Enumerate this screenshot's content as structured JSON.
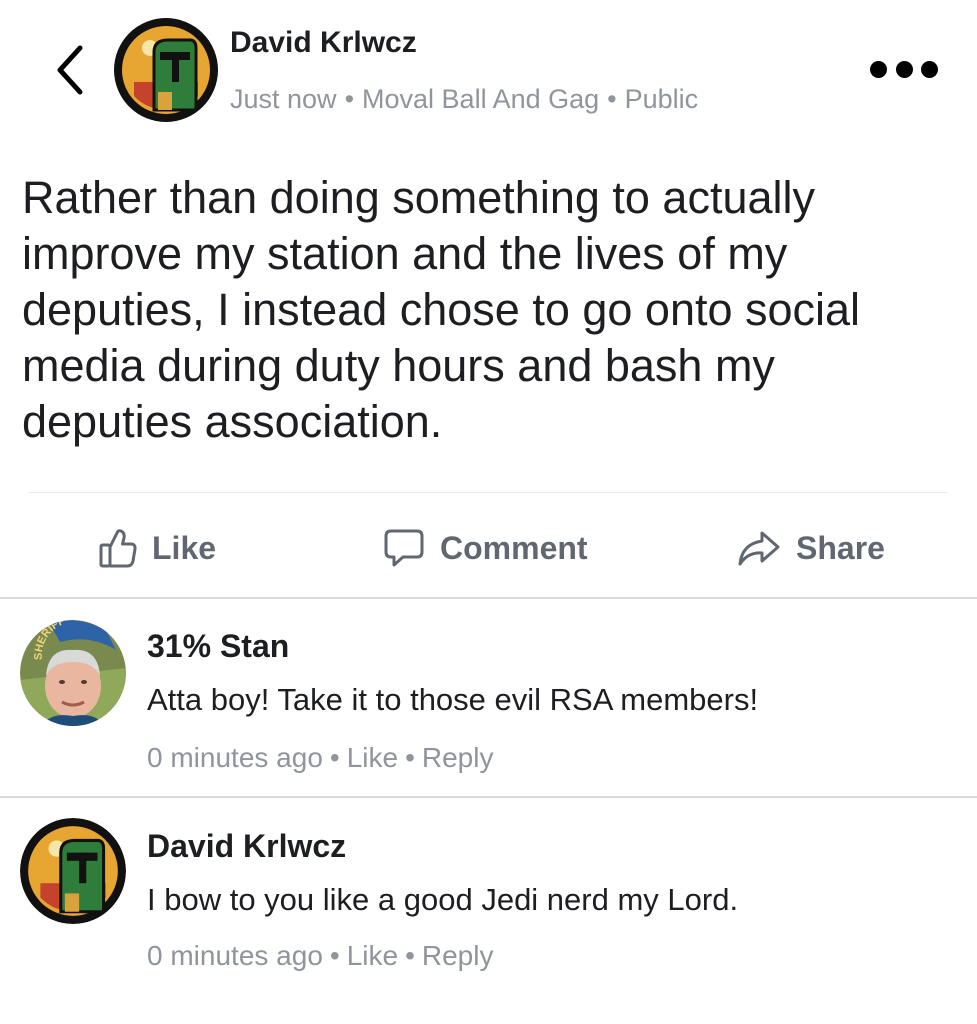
{
  "post": {
    "author": "David Krlwcz",
    "time": "Just now",
    "group": "Moval Ball And Gag",
    "privacy": "Public",
    "text": "Rather than doing something to actually improve my station and the lives of my deputies, I instead chose to go onto social media during duty hours and bash my deputies association."
  },
  "actions": {
    "like": "Like",
    "comment": "Comment",
    "share": "Share"
  },
  "comments": [
    {
      "author": "31% Stan",
      "text": "Atta boy! Take it to those evil RSA members!",
      "time": "0 minutes ago",
      "like": "Like",
      "reply": "Reply"
    },
    {
      "author": "David Krlwcz",
      "text": "I bow to you like a good Jedi nerd my Lord.",
      "time": "0 minutes ago",
      "like": "Like",
      "reply": "Reply"
    }
  ],
  "meta_separator": "•",
  "avatar_badge_text": "SHERIFF",
  "icons": {
    "back": "chevron-left-icon",
    "more": "more-dots-icon",
    "like": "thumbs-up-icon",
    "comment": "comment-bubble-icon",
    "share": "share-arrow-icon"
  },
  "colors": {
    "text": "#1c1e21",
    "secondary": "#90949c",
    "action": "#606770",
    "divider": "#d7d9dc"
  }
}
